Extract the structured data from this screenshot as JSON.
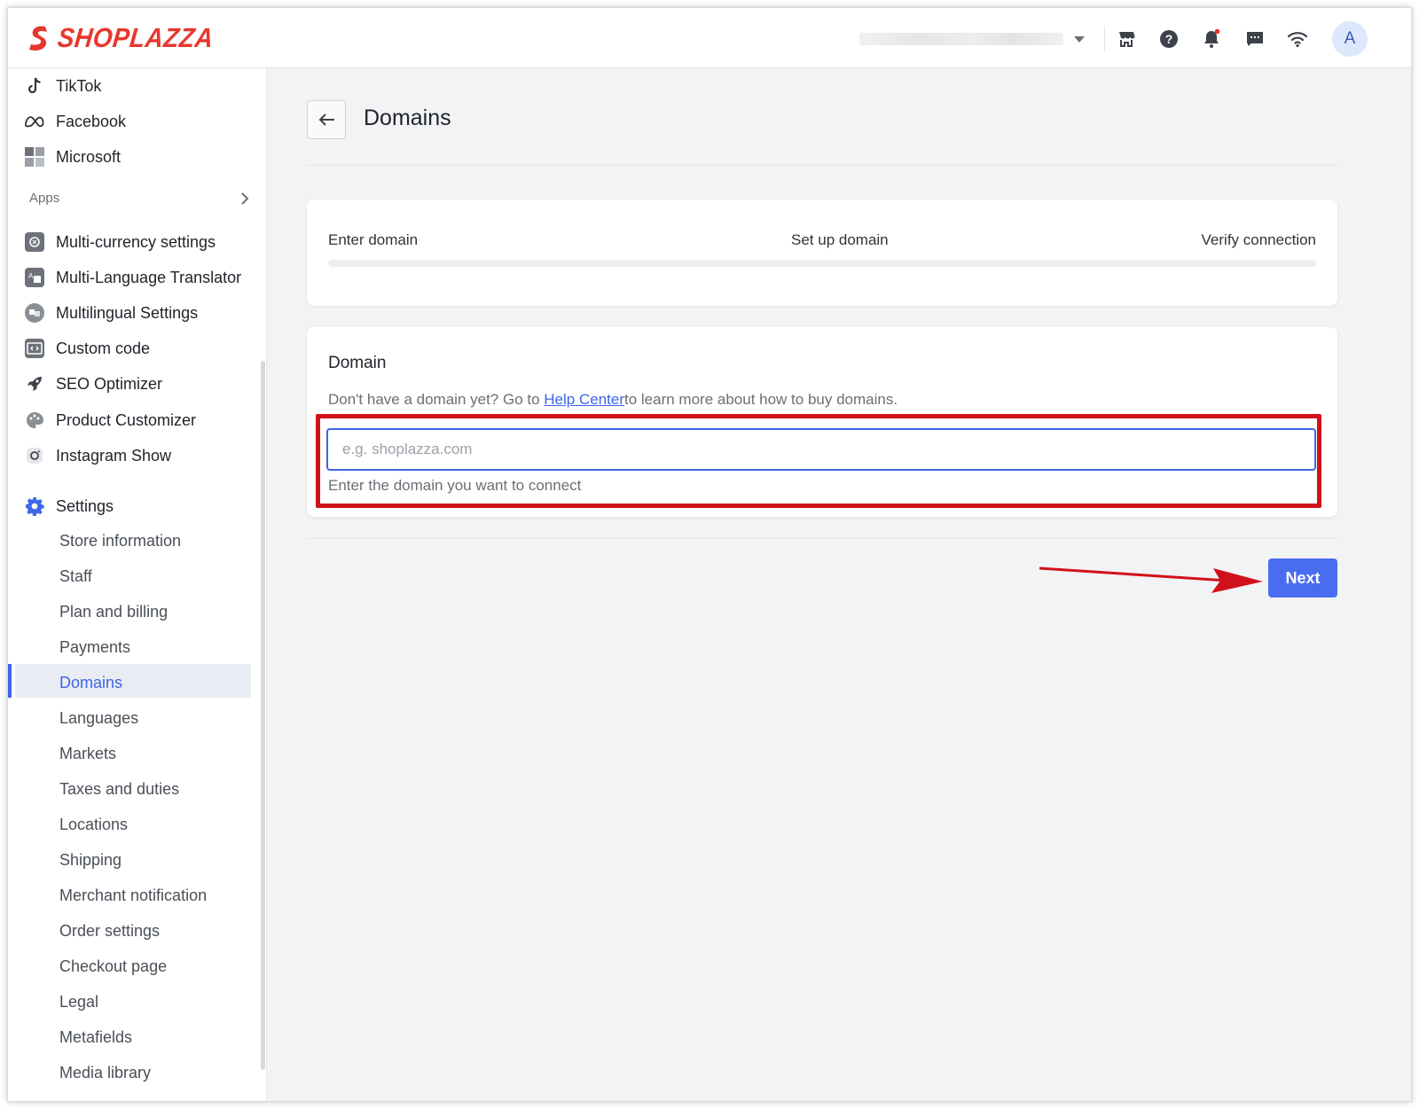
{
  "header": {
    "brand": "SHOPLAZZA",
    "avatar_initial": "A",
    "icons": [
      "store-icon",
      "help-icon",
      "bell-icon",
      "chat-icon",
      "wifi-icon"
    ],
    "notification_color": "#e8372e"
  },
  "sidebar": {
    "channels": [
      {
        "label": "TikTok",
        "icon": "tiktok-icon"
      },
      {
        "label": "Facebook",
        "icon": "meta-icon"
      },
      {
        "label": "Microsoft",
        "icon": "microsoft-icon"
      }
    ],
    "apps_title": "Apps",
    "apps": [
      {
        "label": "Multi-currency settings",
        "icon": "currency-icon"
      },
      {
        "label": "Multi-Language Translator",
        "icon": "translate-icon"
      },
      {
        "label": "Multilingual Settings",
        "icon": "language-icon"
      },
      {
        "label": "Custom code",
        "icon": "code-icon"
      },
      {
        "label": "SEO Optimizer",
        "icon": "rocket-icon"
      },
      {
        "label": "Product Customizer",
        "icon": "palette-icon"
      },
      {
        "label": "Instagram Show",
        "icon": "instagram-icon"
      }
    ],
    "settings_label": "Settings",
    "settings_items": [
      "Store information",
      "Staff",
      "Plan and billing",
      "Payments",
      "Domains",
      "Languages",
      "Markets",
      "Taxes and duties",
      "Locations",
      "Shipping",
      "Merchant notification",
      "Order settings",
      "Checkout page",
      "Legal",
      "Metafields",
      "Media library"
    ],
    "active_item": "Domains"
  },
  "main": {
    "title": "Domains",
    "steps": [
      "Enter domain",
      "Set up domain",
      "Verify connection"
    ],
    "domain_card": {
      "title": "Domain",
      "help_prefix": "Don't have a domain yet? Go to ",
      "help_link": "Help Center",
      "help_suffix": "to learn more about how to buy domains.",
      "input_value": "",
      "input_placeholder": "e.g. shoplazza.com",
      "hint": "Enter the domain you want to connect"
    },
    "next_label": "Next",
    "accent_color": "#4a6cf0",
    "annotation_color": "#d1111a"
  }
}
